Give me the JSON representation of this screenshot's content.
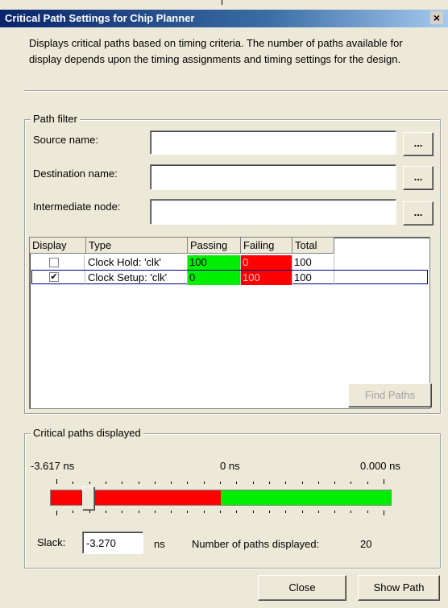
{
  "window": {
    "title": "Critical Path Settings for Chip Planner",
    "close_glyph": "×",
    "description": "Displays critical paths based on timing criteria. The number of paths available for display depends upon the timing assignments and timing settings for the design."
  },
  "path_filter": {
    "legend": "Path filter",
    "source_label": "Source name:",
    "source_value": "",
    "destination_label": "Destination name:",
    "destination_value": "",
    "intermediate_label": "Intermediate node:",
    "intermediate_value": "",
    "browse_label": "...",
    "find_paths_label": "Find Paths"
  },
  "table": {
    "columns": [
      "Display",
      "Type",
      "Passing",
      "Failing",
      "Total"
    ],
    "rows": [
      {
        "display": false,
        "type": "Clock Hold: 'clk'",
        "passing": "100",
        "failing": "0",
        "total": "100"
      },
      {
        "display": true,
        "type": "Clock Setup: 'clk'",
        "passing": "0",
        "failing": "100",
        "total": "100"
      }
    ],
    "colors": {
      "passing": "#00ee00",
      "failing": "#ff0000"
    }
  },
  "critical_paths": {
    "legend": "Critical paths displayed",
    "min_label": "-3.617 ns",
    "mid_label": "0 ns",
    "max_label": "0.000 ns",
    "slider_value_ns": -3.27,
    "failing_fraction": 0.5,
    "slack_label": "Slack:",
    "slack_value": "-3.270",
    "slack_unit": "ns",
    "count_label": "Number of paths displayed:",
    "count_value": "20"
  },
  "buttons": {
    "close_label": "Close",
    "show_path_label": "Show Path"
  }
}
